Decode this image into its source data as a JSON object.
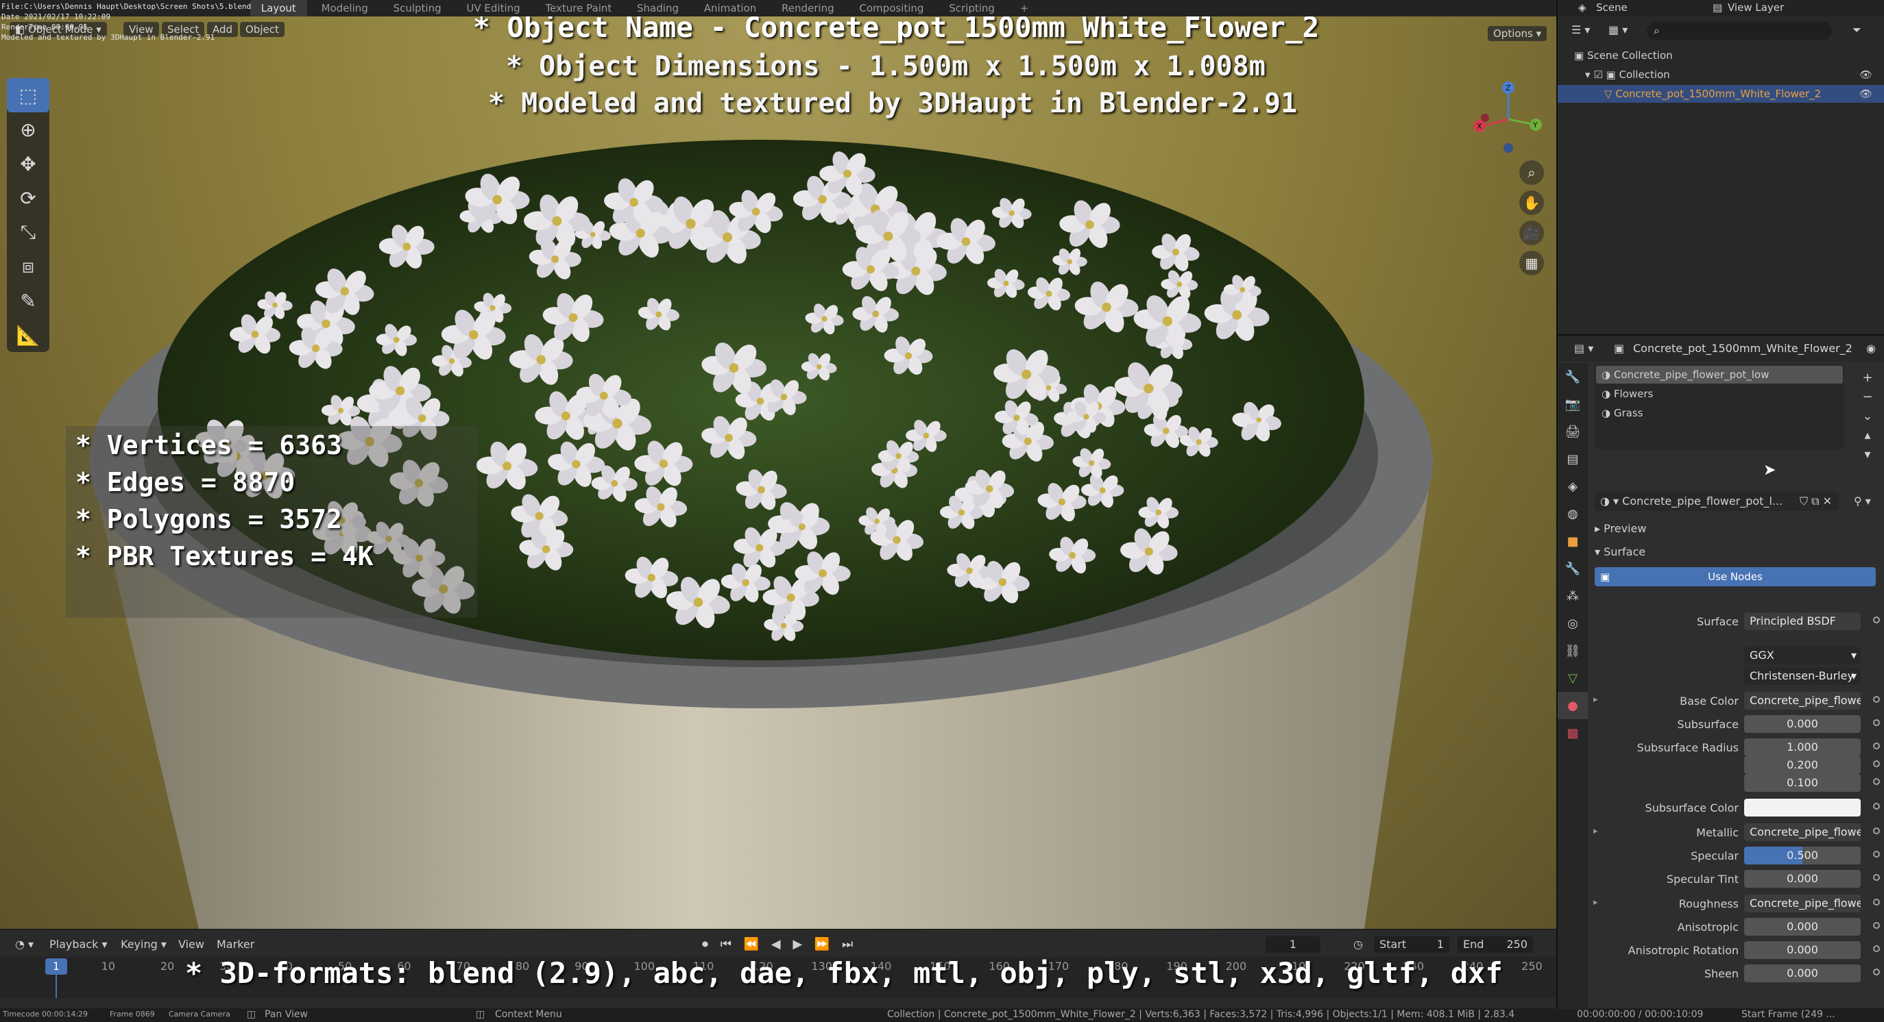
{
  "topbar": {
    "workspaces": [
      "Layout",
      "Modeling",
      "Sculpting",
      "UV Editing",
      "Texture Paint",
      "Shading",
      "Animation",
      "Rendering",
      "Compositing",
      "Scripting"
    ],
    "active_workspace": "Layout",
    "add_tab": "+",
    "scene_label": "Scene",
    "view_layer_label": "View Layer"
  },
  "info_overlay": {
    "line1": "File:C:\\Users\\Dennis Haupt\\Desktop\\Screen Shots\\5.blend",
    "line2": "Date 2021/02/17 10:22:09",
    "line3": "RenderTime 00:00.95",
    "line4": "Modeled and textured by 3DHaupt in Blender-2.91"
  },
  "viewport": {
    "header": {
      "mode": "Object Mode",
      "menus": [
        "View",
        "Select",
        "Add",
        "Object"
      ],
      "options": "Options"
    },
    "overlay_title": "* Object Name - Concrete_pot_1500mm_White_Flower_2",
    "overlay_dimensions": "* Object Dimensions -  1.500m x 1.500m x 1.008m",
    "overlay_credit": "* Modeled and textured by 3DHaupt in Blender-2.91",
    "stats": [
      "* Vertices = 6363",
      "* Edges = 8870",
      "* Polygons = 3572",
      "* PBR Textures = 4K"
    ],
    "gizmo_axes": {
      "x": "X",
      "y": "Y",
      "z": "Z"
    }
  },
  "timeline": {
    "menus": [
      "Playback",
      "Keying",
      "View",
      "Marker"
    ],
    "current_frame": "1",
    "start_label": "Start",
    "start_value": "1",
    "end_label": "End",
    "end_value": "250",
    "ticks": [
      "1",
      "10",
      "20",
      "30",
      "40",
      "50",
      "60",
      "70",
      "80",
      "90",
      "100",
      "110",
      "120",
      "130",
      "140",
      "150",
      "160",
      "170",
      "180",
      "190",
      "200",
      "210",
      "220",
      "230",
      "240",
      "250"
    ],
    "formats_overlay": "* 3D-formats: blend (2.9), abc, dae, fbx, mtl, obj, ply, stl, x3d, gltf, dxf"
  },
  "statusbar": {
    "timecode": "Timecode 00:00:14:29",
    "frame": "Frame 0869",
    "camera": "Camera Camera",
    "pan_view": "Pan View",
    "context_menu": "Context Menu",
    "stats": "Collection | Concrete_pot_1500mm_White_Flower_2 | Verts:6,363 | Faces:3,572 | Tris:4,996 | Objects:1/1 | Mem: 408.1 MiB | 2.83.4",
    "time": "00:00:00:00 / 00:00:10:09",
    "start_frame": "Start Frame (249 ..."
  },
  "outliner": {
    "scene_collection": "Scene Collection",
    "collection": "Collection",
    "object": "Concrete_pot_1500mm_White_Flower_2"
  },
  "properties": {
    "header_object": "Concrete_pot_1500mm_White_Flower_2",
    "material_slots": [
      "Concrete_pipe_flower_pot_low",
      "Flowers",
      "Grass"
    ],
    "material_name": "Concrete_pipe_flower_pot_l...",
    "preview_label": "Preview",
    "surface_label": "Surface",
    "use_nodes": "Use Nodes",
    "rows": [
      {
        "label": "Surface",
        "value": "Principled BSDF",
        "kind": "link"
      },
      {
        "label": "",
        "value": "GGX",
        "kind": "drop"
      },
      {
        "label": "",
        "value": "Christensen-Burley",
        "kind": "drop"
      },
      {
        "label": "Base Color",
        "value": "Concrete_pipe_flowe...",
        "kind": "link"
      },
      {
        "label": "Subsurface",
        "value": "0.000",
        "kind": "num"
      },
      {
        "label": "Subsurface Radius",
        "value": "1.000",
        "kind": "num"
      },
      {
        "label": "",
        "value": "0.200",
        "kind": "num"
      },
      {
        "label": "",
        "value": "0.100",
        "kind": "num"
      },
      {
        "label": "Subsurface Color",
        "value": "",
        "kind": "color"
      },
      {
        "label": "Metallic",
        "value": "Concrete_pipe_flowe...",
        "kind": "link"
      },
      {
        "label": "Specular",
        "value": "0.500",
        "kind": "slider"
      },
      {
        "label": "Specular Tint",
        "value": "0.000",
        "kind": "num"
      },
      {
        "label": "Roughness",
        "value": "Concrete_pipe_flowe...",
        "kind": "link"
      },
      {
        "label": "Anisotropic",
        "value": "0.000",
        "kind": "num"
      },
      {
        "label": "Anisotropic Rotation",
        "value": "0.000",
        "kind": "num"
      },
      {
        "label": "Sheen",
        "value": "0.000",
        "kind": "num"
      }
    ],
    "specular_fraction": 0.5
  },
  "colors": {
    "accent": "#4772b3",
    "panel": "#2e2e2e",
    "viewport_bg": "#8d7f3c"
  }
}
